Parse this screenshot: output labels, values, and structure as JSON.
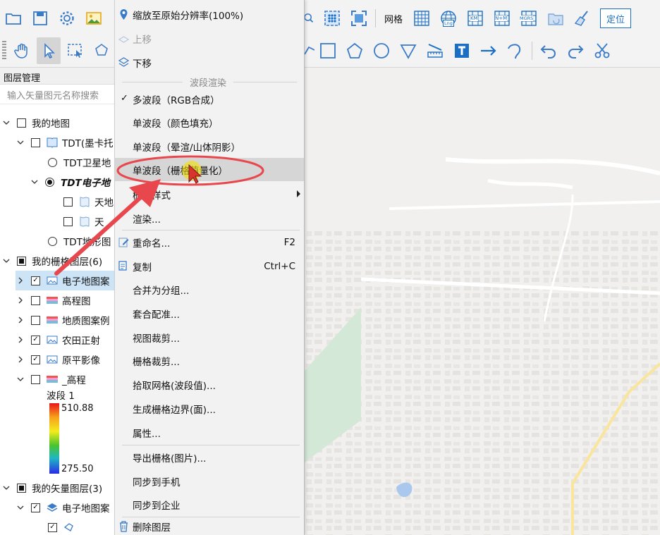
{
  "toolbar": {
    "grid_label": "网格",
    "locate_label": "定位",
    "lng_badge": "Lng",
    "km_badge": "KM",
    "nm_badge": "N+M",
    "mgrs_badge": "MGRS"
  },
  "layer_panel": {
    "title": "图层管理",
    "search_placeholder": "输入矢量图元名称搜索",
    "my_map": "我的地图",
    "tdt_group": "TDT(墨卡托",
    "tdt_satellite": "TDT卫星地",
    "tdt_electronic": "TDT电子地",
    "tian1": "天地",
    "tian2": "天",
    "tdt_terrain": "TDT地形图",
    "raster_group": "我的栅格图层(6)",
    "raster_items": [
      "电子地图案",
      "高程图",
      "地质图案例",
      "农田正射",
      "原平影像",
      "_高程"
    ],
    "band_label": "波段 1",
    "band_max": "510.88",
    "band_min": "275.50",
    "vector_group": "我的矢量图层(3)",
    "vector_item": "电子地图案"
  },
  "context_menu": {
    "zoom_native": "缩放至原始分辨率(100%)",
    "move_up": "上移",
    "move_down": "下移",
    "band_render_header": "波段渲染",
    "multi_band": "多波段（RGB合成）",
    "single_color": "单波段（颜色填充）",
    "single_hillshade": "单波段（晕渲/山体阴影）",
    "single_quantize": "单波段（栅格值量化）",
    "grid_style": "栅格样式",
    "render": "渲染...",
    "rename": "重命名...",
    "rename_shortcut": "F2",
    "copy": "复制",
    "copy_shortcut": "Ctrl+C",
    "merge_group": "合并为分组...",
    "registration": "套合配准...",
    "view_clip": "视图裁剪...",
    "grid_clip": "栅格裁剪...",
    "pick_grid": "拾取网格(波段值)...",
    "gen_boundary": "生成栅格边界(面)...",
    "properties": "属性...",
    "export_grid": "导出栅格(图片)...",
    "sync_phone": "同步到手机",
    "sync_enterprise": "同步到企业",
    "delete_layer": "删除图层"
  },
  "colors": {
    "accent": "#1a6fc4",
    "annotation_red": "#e8474d",
    "highlight": "#cde4f7",
    "menu_hover": "#d6d6d6",
    "cursor_yellow": "#f0e000"
  }
}
